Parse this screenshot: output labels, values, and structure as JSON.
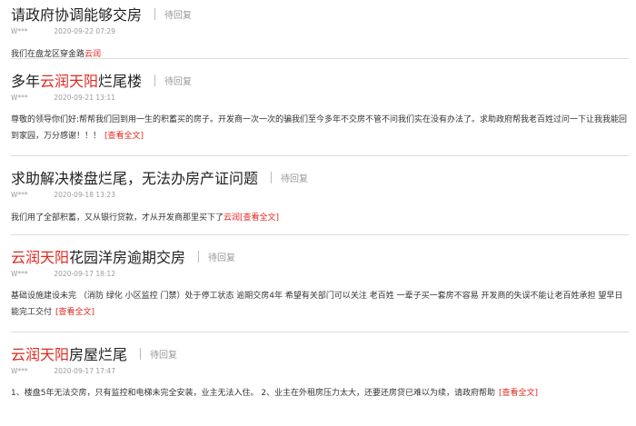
{
  "status_label": "待回复",
  "more_label": "[查看全文]",
  "posts": [
    {
      "title": [
        "请政府协调能够交房"
      ],
      "user": "W***",
      "date": "2020-09-22 07:29",
      "body_before": "我们在盘龙区穿金路",
      "body_link": "云润"
    },
    {
      "title": [
        "多年",
        "云润天阳",
        "烂尾楼"
      ],
      "user": "W***",
      "date": "2020-09-21 13:11",
      "body": "尊敬的领导你们好:帮帮我们回到用一生的积蓄买的房子。开发商一次一次的骗我们至今多年不交房不管不问我们实在没有办法了。求助政府帮我老百姓过问一下让我我能回到家园，万分感谢！！！"
    },
    {
      "title": [
        "求助解决楼盘烂尾，无法办房产证问题"
      ],
      "user": "W***",
      "date": "2020-09-18 13:23",
      "body_before": "我们用了全部积蓄，又从银行贷款，才从开发商那里买下了",
      "body_link": "云润"
    },
    {
      "title": [
        "",
        "云润天阳",
        "花园洋房逾期交房"
      ],
      "user": "W***",
      "date": "2020-09-17 18:12",
      "body": "基础设施建设未完 （消防 绿化 小区监控 门禁）处于停工状态 逾期交房4年 希望有关部门可以关注 老百姓 一辈子买一套房不容易 开发商的失误不能让老百姓承担 望早日能完工交付"
    },
    {
      "title": [
        "",
        "云润天阳",
        "房屋烂尾"
      ],
      "user": "W***",
      "date": "2020-09-17 17:47",
      "body": "1、楼盘5年无法交房，只有监控和电梯未完全安装，业主无法入住。 2、业主在外租房压力太大，还要还房贷已难以为续，请政府帮助"
    }
  ]
}
